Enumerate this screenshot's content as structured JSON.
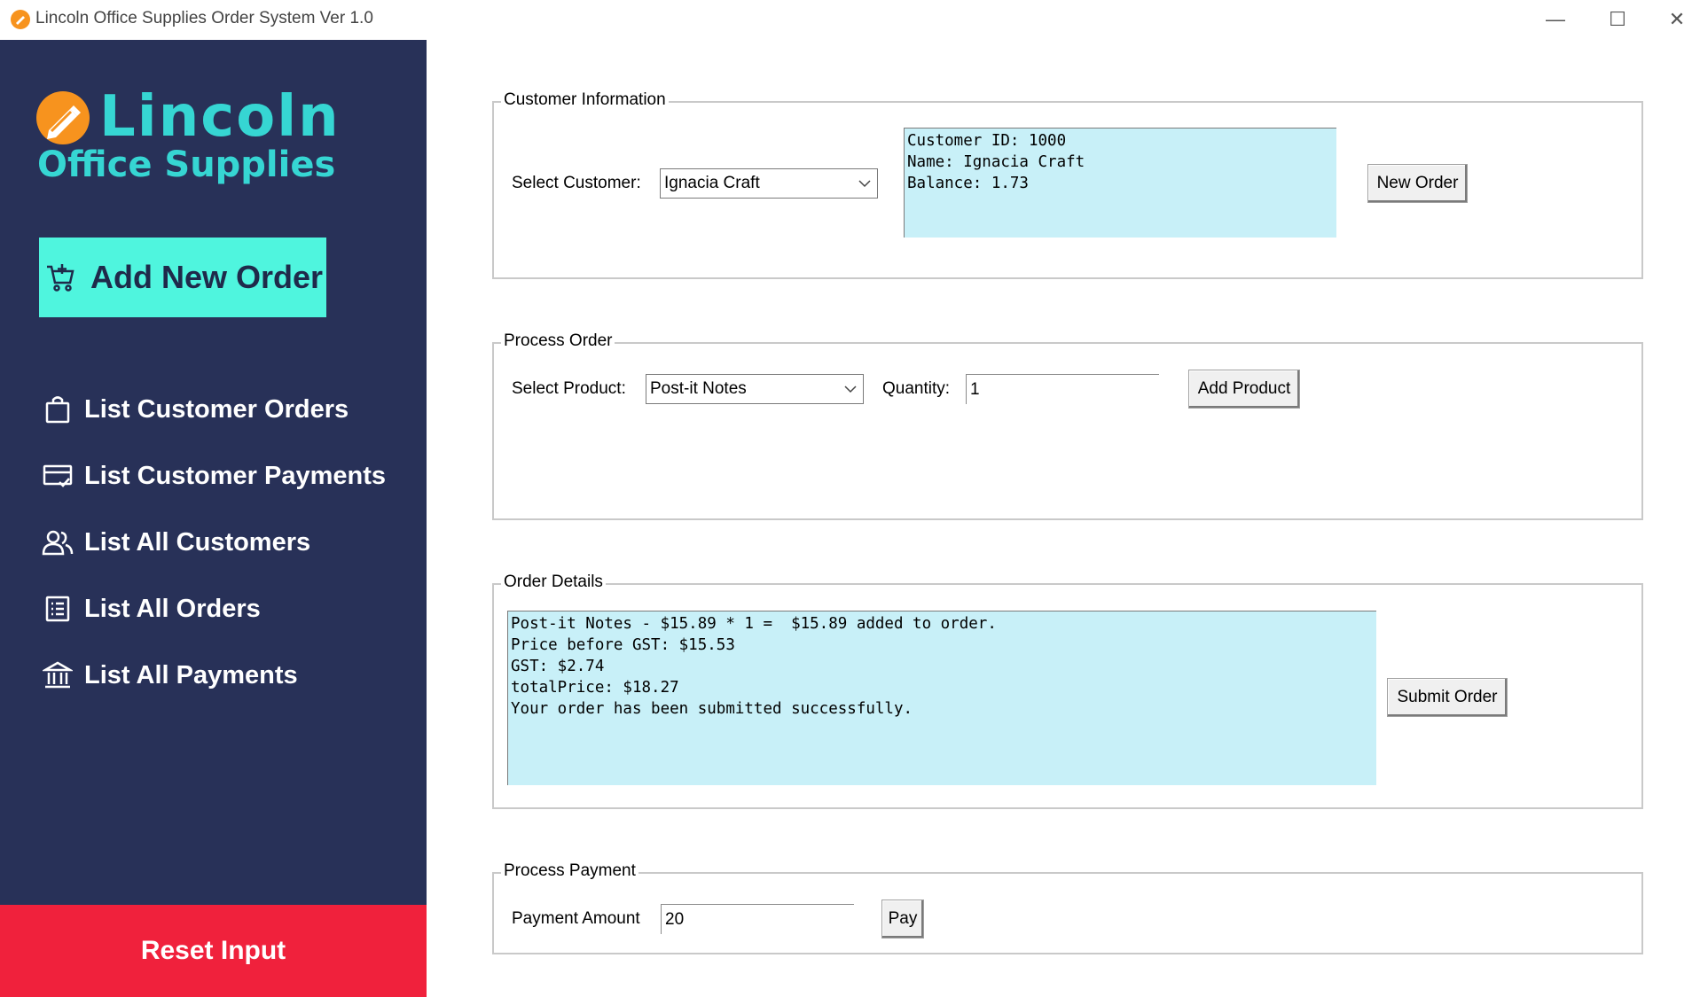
{
  "window": {
    "title": "Lincoln Office Supplies Order System Ver 1.0",
    "minimize": "—",
    "maximize": "☐",
    "close": "✕"
  },
  "sidebar": {
    "logo_title": "Lincoln",
    "logo_subtitle": "Office Supplies",
    "add_order_label": "Add New Order",
    "nav": [
      {
        "label": "List Customer Orders",
        "icon": "shopping-bag-icon"
      },
      {
        "label": "List Customer Payments",
        "icon": "payment-card-icon"
      },
      {
        "label": "List All Customers",
        "icon": "users-icon"
      },
      {
        "label": "List All Orders",
        "icon": "list-icon"
      },
      {
        "label": "List All Payments",
        "icon": "bank-icon"
      }
    ],
    "reset_label": "Reset Input"
  },
  "customer_info": {
    "legend": "Customer Information",
    "select_label": "Select Customer:",
    "selected_customer": "Ignacia Craft",
    "details": "Customer ID: 1000\nName: Ignacia Craft\nBalance: 1.73",
    "new_order_label": "New Order"
  },
  "process_order": {
    "legend": "Process Order",
    "product_label": "Select Product:",
    "selected_product": "Post-it Notes",
    "quantity_label": "Quantity:",
    "quantity_value": "1",
    "add_product_label": "Add Product"
  },
  "order_details": {
    "legend": "Order Details",
    "text": "Post-it Notes - $15.89 * 1 =  $15.89 added to order.\nPrice before GST: $15.53\nGST: $2.74\ntotalPrice: $18.27\nYour order has been submitted successfully.",
    "submit_label": "Submit Order"
  },
  "process_payment": {
    "legend": "Process Payment",
    "amount_label": "Payment Amount",
    "amount_value": "20",
    "pay_label": "Pay"
  },
  "colors": {
    "sidebar_bg": "#283158",
    "accent": "#36d6d3",
    "add_button_bg": "#4ff5de",
    "reset_bg": "#f0213c",
    "logo_orange": "#f7931e",
    "textbox_bg": "#c8f0f8"
  }
}
